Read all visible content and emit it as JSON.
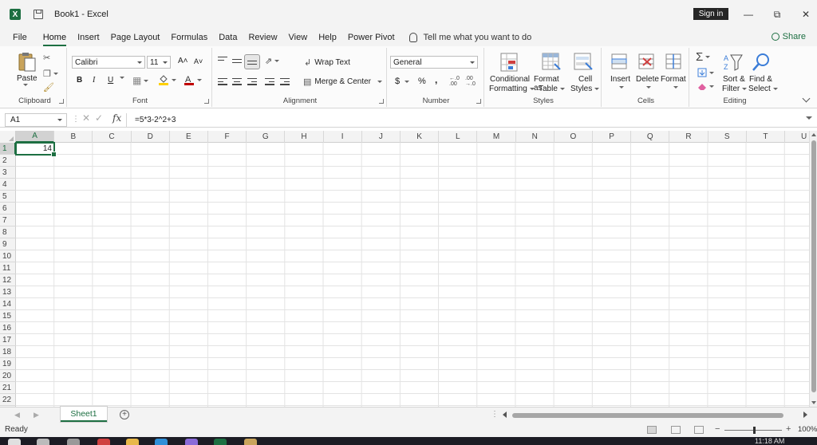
{
  "window": {
    "app_icon": "excel-icon",
    "title": "Book1  -  Excel",
    "sign_in": "Sign in"
  },
  "tabs": [
    "File",
    "Home",
    "Insert",
    "Page Layout",
    "Formulas",
    "Data",
    "Review",
    "View",
    "Help",
    "Power Pivot"
  ],
  "active_tab": "Home",
  "tell_me": "Tell me what you want to do",
  "share": "Share",
  "ribbon": {
    "clipboard": {
      "label": "Clipboard",
      "paste": "Paste"
    },
    "font": {
      "label": "Font",
      "family": "Calibri",
      "size": "11",
      "bold": "B",
      "italic": "I",
      "underline": "U",
      "grow": "A˄",
      "shrink": "A˅",
      "font_color": "#c00000",
      "fill_color": "#ffd000"
    },
    "alignment": {
      "label": "Alignment",
      "wrap_text": "Wrap Text",
      "merge_center": "Merge & Center"
    },
    "number": {
      "label": "Number",
      "format": "General",
      "currency": "$",
      "percent": "%",
      "comma": ",",
      "inc_decimal": "←.0\n.00",
      "dec_decimal": ".00\n→.0"
    },
    "styles": {
      "label": "Styles",
      "conditional_1": "Conditional",
      "conditional_2": "Formatting",
      "format_table_1": "Format as",
      "format_table_2": "Table",
      "cell_styles_1": "Cell",
      "cell_styles_2": "Styles"
    },
    "cells": {
      "label": "Cells",
      "insert": "Insert",
      "delete": "Delete",
      "format": "Format"
    },
    "editing": {
      "label": "Editing",
      "sort_1": "Sort &",
      "sort_2": "Filter",
      "find_1": "Find &",
      "find_2": "Select"
    }
  },
  "formula_bar": {
    "name_box": "A1",
    "fx": "fx",
    "formula": "=5*3-2^2+3"
  },
  "columns": [
    "A",
    "B",
    "C",
    "D",
    "E",
    "F",
    "G",
    "H",
    "I",
    "J",
    "K",
    "L",
    "M",
    "N",
    "O",
    "P",
    "Q",
    "R",
    "S",
    "T",
    "U"
  ],
  "rows": [
    "1",
    "2",
    "3",
    "4",
    "5",
    "6",
    "7",
    "8",
    "9",
    "10",
    "11",
    "12",
    "13",
    "14",
    "15",
    "16",
    "17",
    "18",
    "19",
    "20",
    "21",
    "22"
  ],
  "active_cell": {
    "ref": "A1",
    "value": "14"
  },
  "sheets": [
    "Sheet1"
  ],
  "status": {
    "ready": "Ready",
    "zoom": "100%",
    "zoom_minus": "−",
    "zoom_plus": "+"
  },
  "taskbar": {
    "clock": "11:18 AM"
  },
  "colors": {
    "accent": "#1d6f42"
  }
}
